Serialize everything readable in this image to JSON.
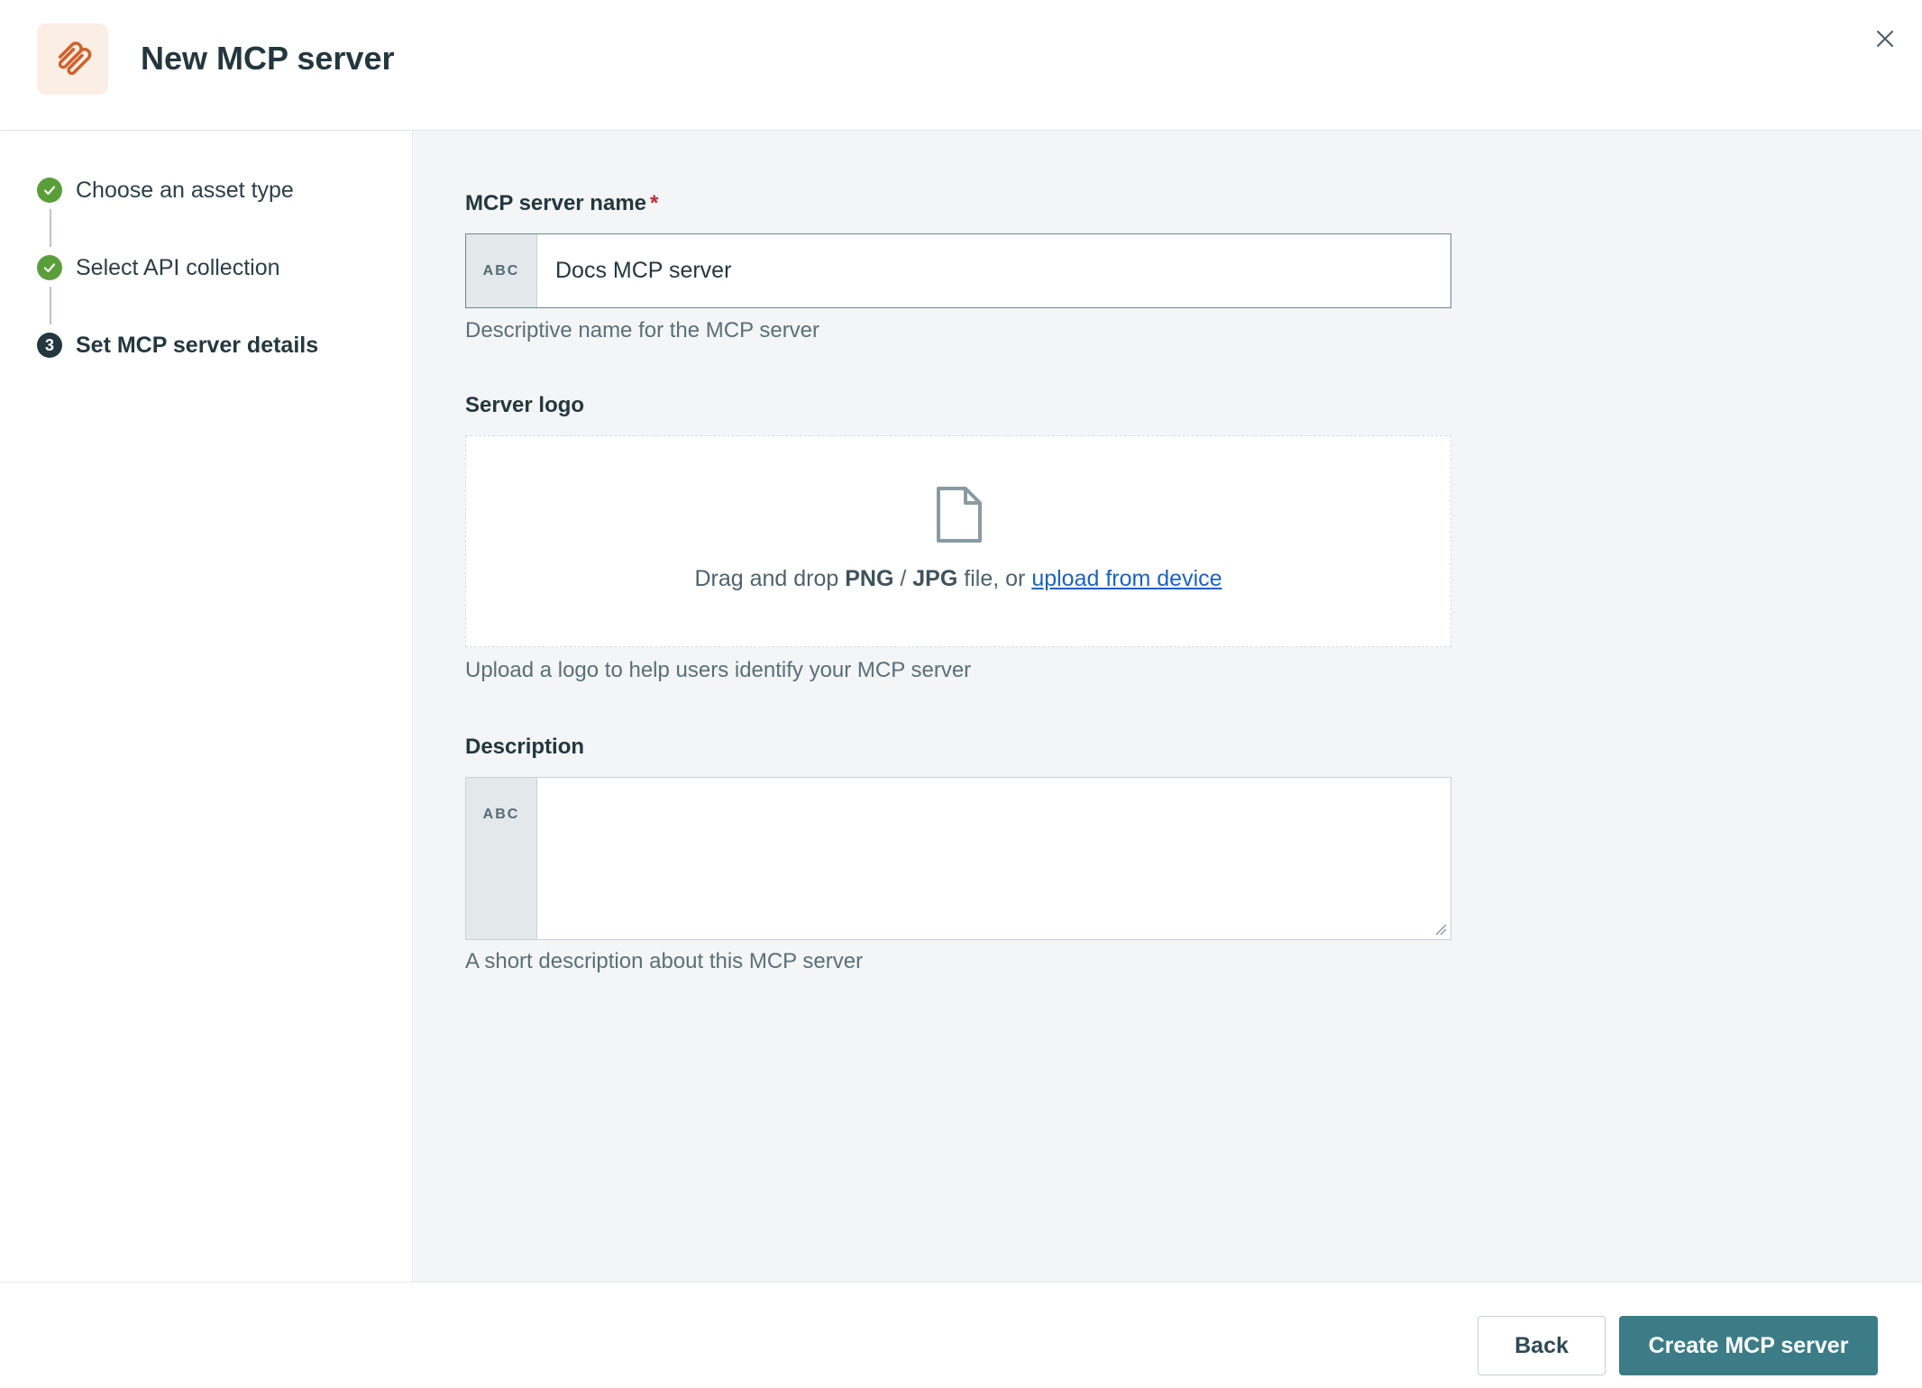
{
  "header": {
    "title": "New MCP server",
    "logo_icon": "paperclip-icon",
    "close_icon": "close-icon"
  },
  "steps": [
    {
      "label": "Choose an asset type",
      "status": "completed",
      "icon": "check-icon"
    },
    {
      "label": "Select API collection",
      "status": "completed",
      "icon": "check-icon"
    },
    {
      "label": "Set MCP server details",
      "status": "current",
      "number": "3"
    }
  ],
  "form": {
    "name": {
      "label": "MCP server name",
      "required_mark": "*",
      "type_badge": "ABC",
      "value": "Docs MCP server",
      "hint": "Descriptive name for the MCP server"
    },
    "logo": {
      "label": "Server logo",
      "icon": "file-icon",
      "drop_prefix": "Drag and drop",
      "format_png": "PNG",
      "separator": "/",
      "format_jpg": "JPG",
      "drop_middle": "file, or",
      "upload_link": "upload from device",
      "hint": "Upload a logo to help users identify your MCP server"
    },
    "description": {
      "label": "Description",
      "type_badge": "ABC",
      "value": "",
      "hint": "A short description about this MCP server"
    }
  },
  "footer": {
    "back_label": "Back",
    "create_label": "Create MCP server"
  },
  "colors": {
    "accent": "#3b7c86",
    "success": "#5a9e3a",
    "link": "#1a63c4",
    "required": "#c1272d",
    "logo_bg": "#fbeee4",
    "logo_icon": "#d0602a"
  }
}
